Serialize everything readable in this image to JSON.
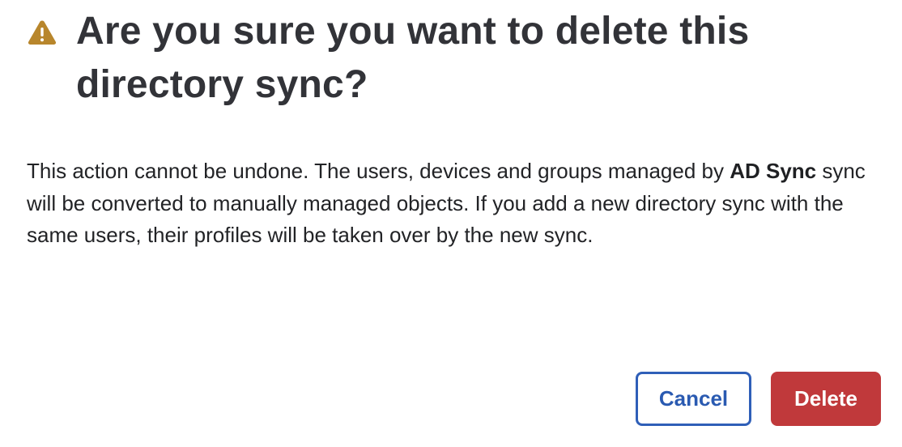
{
  "dialog": {
    "title": "Are you sure you want to delete this directory sync?",
    "icon": "warning-icon",
    "message_before": "This action cannot be undone. The users, devices and groups managed by ",
    "sync_name": "AD Sync",
    "message_after": " sync will be converted to manually managed objects. If you add a new directory sync with the same users, their profiles will be taken over by the new sync.",
    "cancel_label": "Cancel",
    "delete_label": "Delete"
  },
  "colors": {
    "warning": "#b8862c",
    "title": "#323338",
    "cancel_border": "#2f5fb8",
    "cancel_text": "#2a5ab1",
    "delete_bg": "#c0393b"
  }
}
